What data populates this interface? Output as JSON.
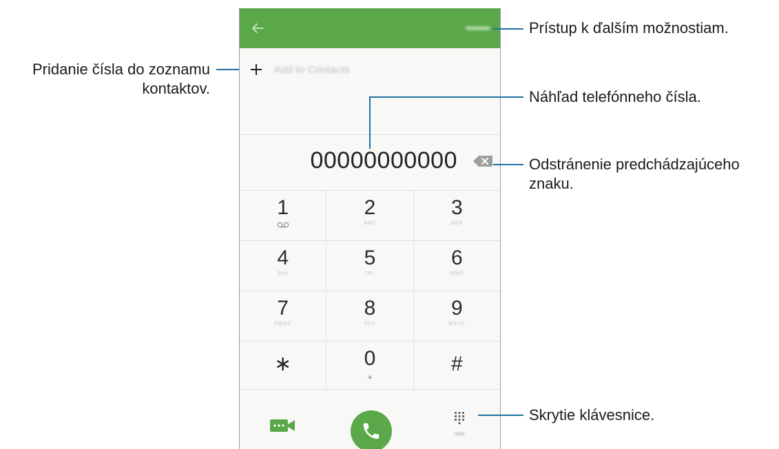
{
  "phone": {
    "add_contact_label": "Add to Contacts",
    "number": "00000000000",
    "keys": [
      {
        "digit": "1",
        "letters": ""
      },
      {
        "digit": "2",
        "letters": "ABC"
      },
      {
        "digit": "3",
        "letters": "DEF"
      },
      {
        "digit": "4",
        "letters": "GHI"
      },
      {
        "digit": "5",
        "letters": "JKL"
      },
      {
        "digit": "6",
        "letters": "MNO"
      },
      {
        "digit": "7",
        "letters": "PQRS"
      },
      {
        "digit": "8",
        "letters": "TUV"
      },
      {
        "digit": "9",
        "letters": "WXYZ"
      },
      {
        "digit": "∗",
        "letters": ""
      },
      {
        "digit": "0",
        "letters": "+"
      },
      {
        "digit": "#",
        "letters": ""
      }
    ],
    "hide_label": "Hide",
    "accent_color": "#5aa84a"
  },
  "callouts": {
    "more_options": "Prístup k ďalším možnostiam.",
    "add_number_line1": "Pridanie čísla do zoznamu",
    "add_number_line2": "kontaktov.",
    "preview": "Náhľad telefónneho čísla.",
    "delete_line1": "Odstránenie predchádzajúceho",
    "delete_line2": "znaku.",
    "hide_keypad": "Skrytie klávesnice."
  },
  "icons": {
    "back": "arrow-left-icon",
    "plus": "plus-icon",
    "backspace": "backspace-icon",
    "voicemail": "voicemail-icon",
    "video": "video-call-icon",
    "call": "phone-icon",
    "keypad": "keypad-icon"
  }
}
